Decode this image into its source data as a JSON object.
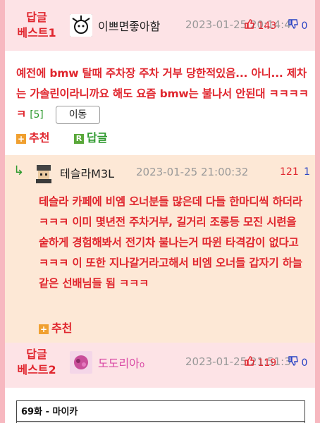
{
  "colors": {
    "accent_red": "#e0262e",
    "vote_blue": "#2a44c4",
    "reply_green": "#2f9a2f",
    "header_pink": "#fde3e6",
    "reply_bg": "#fde8d6"
  },
  "best1": {
    "label_line1": "답글",
    "label_line2": "베스트1",
    "nickname": "이쁘면좋아함",
    "date": "2023-01-25 20:14:4",
    "up": "143",
    "down": "0",
    "text": "예전에 bmw 탈때 주차장 주차 거부 당한적있음... 아니... 제차는 가솔린이라니까요 해도 요즘 bmw는 불나서 안된대 ㅋㅋㅋㅋㅋ",
    "count": "[5]",
    "move_button": "이동",
    "recommend": "추천",
    "reply": "답글"
  },
  "reply": {
    "nickname": "테슬라M3L",
    "date": "2023-01-25 21:00:32",
    "up": "121",
    "down": "1",
    "text": "테슬라 카페에 비엠 오너분들 많은데 다들 한마디씩 하더라 ㅋㅋㅋ 이미 몇년전 주차거부, 길거리 조롱등 모진 시련을 숱하게 경험해봐서 전기차 불나는거 따윈 타격감이 없다고ㅋㅋㅋ 이 또한 지나갈거라고해서 비엠 오너들 갑자기 하늘같은 선배님들 됨 ㅋㅋㅋ",
    "recommend": "추천"
  },
  "best2": {
    "label_line1": "답글",
    "label_line2": "베스트2",
    "nickname": "도도리아",
    "date": "2023-01-25 21:51:3",
    "up": "119",
    "down": "0"
  },
  "comic": {
    "title": "69화 - 마이카"
  }
}
